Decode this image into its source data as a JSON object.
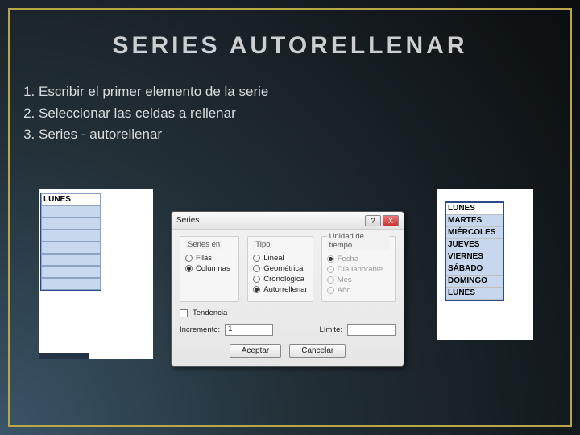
{
  "title": "SERIES AUTORELLENAR",
  "instructions": [
    "Escribir el primer elemento de la serie",
    "Seleccionar las celdas a rellenar",
    "Series - autorellenar"
  ],
  "left_sheet": {
    "cells": [
      "LUNES",
      "",
      "",
      "",
      "",
      "",
      "",
      ""
    ]
  },
  "dialog": {
    "title": "Series",
    "help_icon": "?",
    "close_icon": "X",
    "groups": {
      "series_en": {
        "label": "Series en",
        "options": [
          {
            "label": "Filas",
            "selected": false
          },
          {
            "label": "Columnas",
            "selected": true
          }
        ]
      },
      "tipo": {
        "label": "Tipo",
        "options": [
          {
            "label": "Lineal",
            "selected": false
          },
          {
            "label": "Geométrica",
            "selected": false
          },
          {
            "label": "Cronológica",
            "selected": false
          },
          {
            "label": "Autorrellenar",
            "selected": true
          }
        ]
      },
      "unidad": {
        "label": "Unidad de tiempo",
        "options": [
          {
            "label": "Fecha",
            "selected": true,
            "disabled": true
          },
          {
            "label": "Día laborable",
            "selected": false,
            "disabled": true
          },
          {
            "label": "Mes",
            "selected": false,
            "disabled": true
          },
          {
            "label": "Año",
            "selected": false,
            "disabled": true
          }
        ]
      }
    },
    "tendencia_label": "Tendencia",
    "incremento_label": "Incremento:",
    "incremento_value": "1",
    "limite_label": "Límite:",
    "limite_value": "",
    "accept": "Aceptar",
    "cancel": "Cancelar"
  },
  "right_sheet": {
    "cells": [
      "LUNES",
      "MARTES",
      "MIÉRCOLES",
      "JUEVES",
      "VIERNES",
      "SÁBADO",
      "DOMINGO",
      "LUNES"
    ]
  }
}
